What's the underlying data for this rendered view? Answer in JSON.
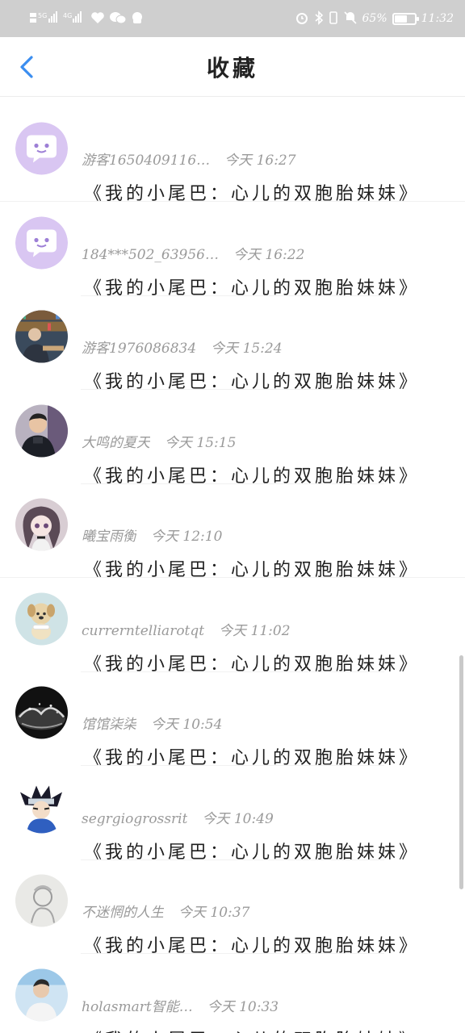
{
  "status_bar": {
    "left_icons": [
      "sim-signal-icon",
      "wifi-signal-icon",
      "signal-icon",
      "heart-icon",
      "wechat-icon",
      "app-icon"
    ],
    "signal_label_1": "5G",
    "signal_label_2": "4G",
    "battery_percent": "65%",
    "battery_level": 0.65,
    "time": "11:32"
  },
  "header": {
    "title": "收藏",
    "back_icon": "chevron-left-icon"
  },
  "items": [
    {
      "username": "游客1650409116…",
      "time": "今天 16:27",
      "comment": "《我的小尾巴：心儿的双胞胎妹妹》",
      "avatar": "default-chat-avatar"
    },
    {
      "username": "184***502_63956…",
      "time": "今天 16:22",
      "comment": "《我的小尾巴：心儿的双胞胎妹妹》",
      "avatar": "default-chat-avatar"
    },
    {
      "username": "游客1976086834",
      "time": "今天 15:24",
      "comment": "《我的小尾巴：心儿的双胞胎妹妹》",
      "avatar": "library-photo-avatar"
    },
    {
      "username": "大鸣的夏天",
      "time": "今天 15:15",
      "comment": "《我的小尾巴：心儿的双胞胎妹妹》",
      "avatar": "man-photo-avatar"
    },
    {
      "username": "曦宝雨衡",
      "time": "今天 12:10",
      "comment": "《我的小尾巴：心儿的双胞胎妹妹》",
      "avatar": "anime-girl-avatar"
    },
    {
      "username": "currerntelliarotqt",
      "time": "今天 11:02",
      "comment": "《我的小尾巴：心儿的双胞胎妹妹》",
      "avatar": "puppy-avatar"
    },
    {
      "username": "馆馆柒柒",
      "time": "今天 10:54",
      "comment": "《我的小尾巴：心儿的双胞胎妹妹》",
      "avatar": "splash-avatar"
    },
    {
      "username": "segrgiogrossrit",
      "time": "今天 10:49",
      "comment": "《我的小尾巴：心儿的双胞胎妹妹》",
      "avatar": "anime-ninja-avatar"
    },
    {
      "username": "不迷惘的人生",
      "time": "今天 10:37",
      "comment": "《我的小尾巴：心儿的双胞胎妹妹》",
      "avatar": "sketch-avatar"
    },
    {
      "username": "holasmart智能…",
      "time": "今天 10:33",
      "comment": "《我的小尾巴：心儿的双胞胎妹妹》",
      "avatar": "person-photo-avatar"
    }
  ],
  "colors": {
    "accent": "#3b8ef0",
    "default_avatar_bg": "#d9c6f2",
    "default_avatar_icon": "#ffffff",
    "meta_text": "#9a9a9a",
    "status_bar_bg": "#cfcfcf"
  }
}
